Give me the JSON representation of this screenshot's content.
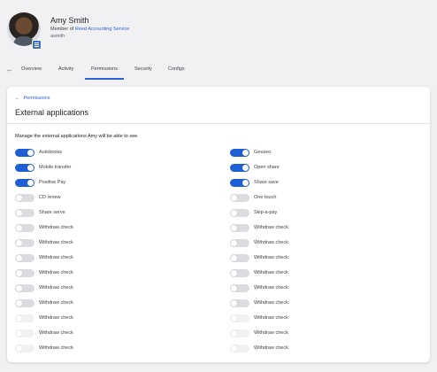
{
  "profile": {
    "name": "Amy Smith",
    "member_prefix": "Member of",
    "organization": "Reed Accounting Service",
    "username": "asmith"
  },
  "tabs": [
    {
      "label": "Overview",
      "active": false
    },
    {
      "label": "Activity",
      "active": false
    },
    {
      "label": "Permissions",
      "active": true
    },
    {
      "label": "Security",
      "active": false
    },
    {
      "label": "Configs",
      "active": false
    }
  ],
  "card": {
    "breadcrumb": "Permissions",
    "title": "External applications",
    "description": "Manage the external applications Amy will be able to see."
  },
  "left_column": [
    {
      "label": "Autobooks",
      "state": "on"
    },
    {
      "label": "Mobile transfer",
      "state": "on"
    },
    {
      "label": "Positive Pay",
      "state": "on"
    },
    {
      "label": "CD renew",
      "state": "off"
    },
    {
      "label": "Share serve",
      "state": "off"
    },
    {
      "label": "Withdraw check",
      "state": "off"
    },
    {
      "label": "Withdraw check",
      "state": "off"
    },
    {
      "label": "Withdraw check",
      "state": "off"
    },
    {
      "label": "Withdraw check",
      "state": "off"
    },
    {
      "label": "Withdraw check",
      "state": "off"
    },
    {
      "label": "Withdraw check",
      "state": "off"
    },
    {
      "label": "Withdraw check",
      "state": "disabled"
    },
    {
      "label": "Withdraw check",
      "state": "disabled"
    },
    {
      "label": "Withdraw check",
      "state": "disabled"
    }
  ],
  "right_column": [
    {
      "label": "Geezeo",
      "state": "on"
    },
    {
      "label": "Open share",
      "state": "on"
    },
    {
      "label": "Share save",
      "state": "on"
    },
    {
      "label": "One touch",
      "state": "off"
    },
    {
      "label": "Skip-a-pay",
      "state": "off"
    },
    {
      "label": "Withdraw check",
      "state": "off"
    },
    {
      "label": "Withdraw check",
      "state": "off"
    },
    {
      "label": "Withdraw check",
      "state": "off"
    },
    {
      "label": "Withdraw check",
      "state": "off"
    },
    {
      "label": "Withdraw check",
      "state": "off"
    },
    {
      "label": "Withdraw check",
      "state": "off"
    },
    {
      "label": "Withdraw check",
      "state": "disabled"
    },
    {
      "label": "Withdraw check",
      "state": "disabled"
    },
    {
      "label": "Withdraw check",
      "state": "disabled"
    }
  ],
  "colors": {
    "accent": "#1f5fd6",
    "link": "#2f5fd0",
    "switch_off": "#dadce0",
    "switch_disabled": "#f0f1f3"
  }
}
